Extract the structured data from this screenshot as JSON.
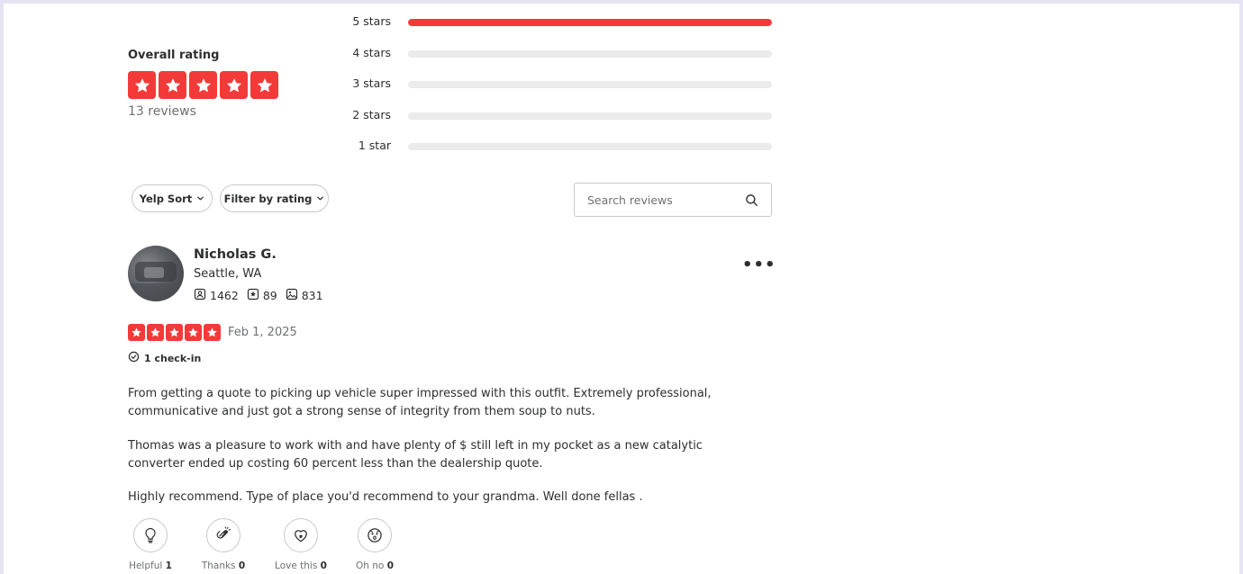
{
  "overall": {
    "label": "Overall rating",
    "rating": 5,
    "review_count": "13 reviews"
  },
  "distribution": [
    {
      "label": "5 stars",
      "fraction": 1.0
    },
    {
      "label": "4 stars",
      "fraction": 0
    },
    {
      "label": "3 stars",
      "fraction": 0
    },
    {
      "label": "2 stars",
      "fraction": 0
    },
    {
      "label": "1 star",
      "fraction": 0
    }
  ],
  "controls": {
    "sort_label": "Yelp Sort",
    "filter_label": "Filter by rating",
    "search_placeholder": "Search reviews"
  },
  "review": {
    "user": {
      "name": "Nicholas G.",
      "location": "Seattle, WA",
      "friends": "1462",
      "reviews": "89",
      "photos": "831"
    },
    "rating": 5,
    "date": "Feb 1, 2025",
    "checkin": "1 check-in",
    "paragraphs": [
      "From getting a quote to picking up vehicle super impressed with this outfit. Extremely professional, communicative and just got a strong sense of integrity from them soup to nuts.",
      "Thomas was a pleasure to work with and have plenty of $ still left in my pocket as a new catalytic converter ended up costing 60 percent less than the dealership quote.",
      "Highly recommend. Type of place you'd recommend to your grandma. Well done fellas ."
    ],
    "reactions": [
      {
        "label": "Helpful",
        "count": "1",
        "icon": "lightbulb-icon"
      },
      {
        "label": "Thanks",
        "count": "0",
        "icon": "clapping-hands-icon"
      },
      {
        "label": "Love this",
        "count": "0",
        "icon": "heart-icon"
      },
      {
        "label": "Oh no",
        "count": "0",
        "icon": "surprised-face-icon"
      }
    ]
  },
  "colors": {
    "brand_red": "#f43939",
    "track_gray": "#ebebeb",
    "border_gray": "#c8c9ca"
  }
}
